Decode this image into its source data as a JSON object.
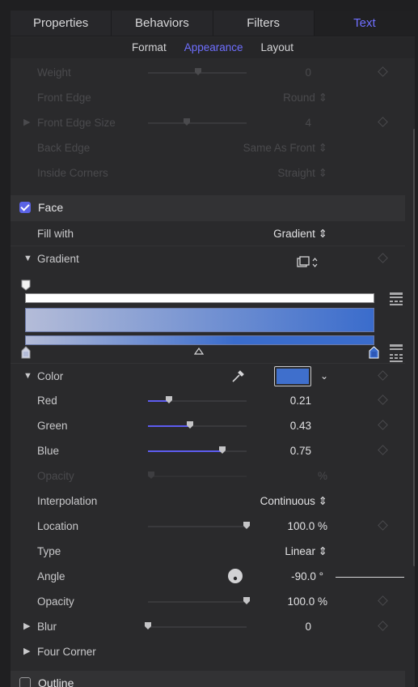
{
  "tabs": {
    "items": [
      {
        "label": "Properties"
      },
      {
        "label": "Behaviors"
      },
      {
        "label": "Filters"
      },
      {
        "label": "Text"
      }
    ]
  },
  "subtabs": {
    "items": [
      {
        "label": "Format"
      },
      {
        "label": "Appearance"
      },
      {
        "label": "Layout"
      }
    ]
  },
  "edge_rows": [
    {
      "label": "Weight",
      "value": "0"
    },
    {
      "label": "Front Edge",
      "value": "Round ⇕"
    },
    {
      "label": "Front Edge Size",
      "value": "4"
    },
    {
      "label": "Back Edge",
      "value": "Same As Front ⇕"
    },
    {
      "label": "Inside Corners",
      "value": "Straight ⇕"
    }
  ],
  "face": {
    "label": "Face",
    "checked": true,
    "fill_with_label": "Fill with",
    "fill_with_value": "Gradient ⇕",
    "gradient_label": "Gradient",
    "color_label": "Color",
    "swatch_color": "#3f6fcc",
    "gradient_start": "#b4bcd8",
    "gradient_end": "#3a6ccc",
    "rows": [
      {
        "label": "Red",
        "value": "0.21",
        "level": 0.21
      },
      {
        "label": "Green",
        "value": "0.43",
        "level": 0.43
      },
      {
        "label": "Blue",
        "value": "0.75",
        "level": 0.75
      },
      {
        "label": "Opacity",
        "value": "%"
      },
      {
        "label": "Interpolation",
        "value": "Continuous ⇕"
      },
      {
        "label": "Location",
        "value": "100.0 %",
        "level": 1.0
      },
      {
        "label": "Type",
        "value": "Linear ⇕"
      },
      {
        "label": "Angle",
        "value": "-90.0 °"
      },
      {
        "label": "Opacity",
        "value": "100.0 %",
        "level": 1.0
      },
      {
        "label": "Blur",
        "value": "0",
        "level": 0.0
      },
      {
        "label": "Four Corner"
      }
    ]
  },
  "outline": {
    "label": "Outline",
    "checked": false
  }
}
